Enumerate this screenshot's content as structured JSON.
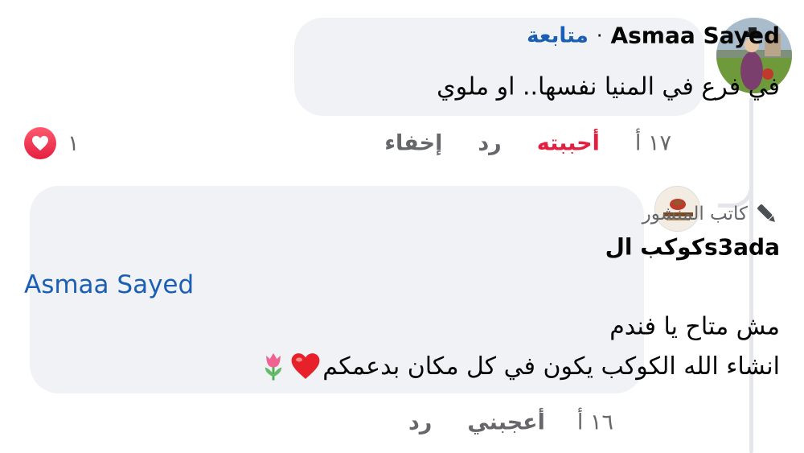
{
  "comment": {
    "author": "Asmaa Sayed",
    "separator": "·",
    "follow_label": "متابعة",
    "text": "في فرع في المنيا نفسها.. او ملوي",
    "time": "١٧ أ",
    "like_label": "أحببته",
    "reply_label": "رد",
    "hide_label": "إخفاء",
    "reaction_count": "١",
    "reaction_icon": "heart-icon",
    "like_color": "#e41e3f"
  },
  "reply": {
    "badge_label": "كاتب المنشور",
    "badge_icon": "pencil-icon",
    "author": "كوكب الs3ada",
    "mention": "Asmaa Sayed",
    "line1": "مش متاح يا فندم",
    "line2": "انشاء الله الكوكب يكون في كل مكان بدعمكم",
    "line2_emojis": [
      "red-heart-emoji",
      "tulip-emoji"
    ],
    "time": "١٦ أ",
    "like_label": "أعجبني",
    "reply_label": "رد"
  },
  "colors": {
    "bubble": "#f0f2f5",
    "link": "#1b5fb4",
    "meta": "#65676b"
  }
}
